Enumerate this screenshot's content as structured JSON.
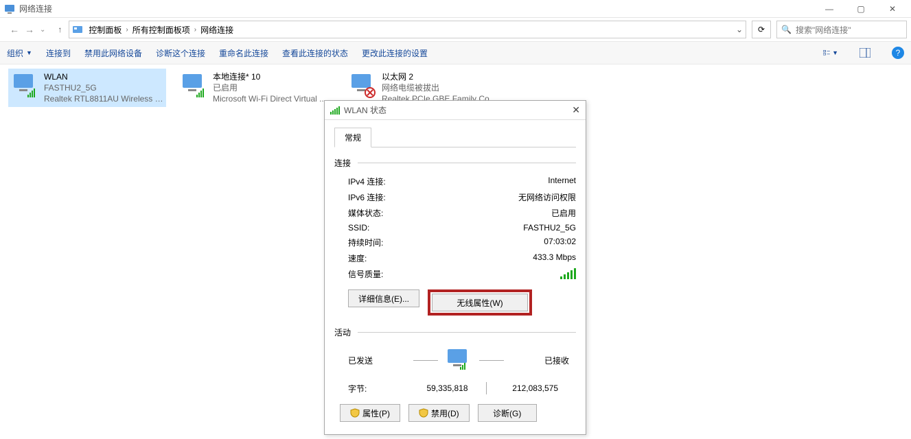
{
  "window": {
    "title": "网络连接",
    "controls": {
      "min": "—",
      "max": "▢",
      "close": "✕"
    }
  },
  "nav": {
    "crumbs": [
      "控制面板",
      "所有控制面板项",
      "网络连接"
    ],
    "dropdown_glyph": "⌄",
    "refresh_glyph": "⟳",
    "search_placeholder": "搜索\"网络连接\"",
    "search_icon": "🔍"
  },
  "toolbar": {
    "organize": "组织",
    "items": [
      "连接到",
      "禁用此网络设备",
      "诊断这个连接",
      "重命名此连接",
      "查看此连接的状态",
      "更改此连接的设置"
    ]
  },
  "connections": [
    {
      "name": "WLAN",
      "status": "FASTHU2_5G",
      "device": "Realtek RTL8811AU Wireless L...",
      "selected": true,
      "type": "wifi"
    },
    {
      "name": "本地连接* 10",
      "status": "已启用",
      "device": "Microsoft Wi-Fi Direct Virtual ...",
      "selected": false,
      "type": "wifi"
    },
    {
      "name": "以太网 2",
      "status": "网络电缆被拔出",
      "device": "Realtek PCIe GBE Family Contr...",
      "selected": false,
      "type": "eth-unplugged"
    }
  ],
  "dialog": {
    "title": "WLAN 状态",
    "tab": "常规",
    "section_connection": "连接",
    "rows": {
      "ipv4_label": "IPv4 连接:",
      "ipv4_value": "Internet",
      "ipv6_label": "IPv6 连接:",
      "ipv6_value": "无网络访问权限",
      "media_label": "媒体状态:",
      "media_value": "已启用",
      "ssid_label": "SSID:",
      "ssid_value": "FASTHU2_5G",
      "duration_label": "持续时间:",
      "duration_value": "07:03:02",
      "speed_label": "速度:",
      "speed_value": "433.3 Mbps",
      "signal_label": "信号质量:"
    },
    "buttons": {
      "details": "详细信息(E)...",
      "wireless_props": "无线属性(W)"
    },
    "section_activity": "活动",
    "activity": {
      "sent_label": "已发送",
      "recv_label": "已接收",
      "bytes_label": "字节:",
      "sent_bytes": "59,335,818",
      "recv_bytes": "212,083,575"
    },
    "footer": {
      "props": "属性(P)",
      "disable": "禁用(D)",
      "diagnose": "诊断(G)"
    }
  }
}
